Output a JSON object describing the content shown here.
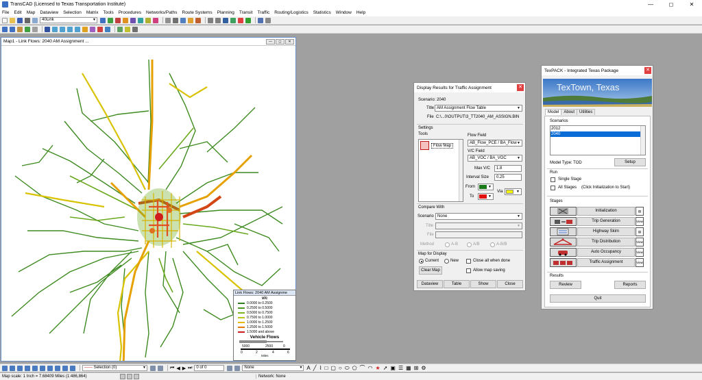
{
  "app": {
    "title": "TransCAD (Licensed to Texas Transportation Institute)",
    "win_min": "—",
    "win_max": "◻",
    "win_close": "✕"
  },
  "menu": [
    "File",
    "Edit",
    "Map",
    "Dataview",
    "Selection",
    "Matrix",
    "Tools",
    "Procedures",
    "Networks/Paths",
    "Route Systems",
    "Planning",
    "Transit",
    "Traffic",
    "Routing/Logistics",
    "Statistics",
    "Window",
    "Help"
  ],
  "toolbar": {
    "layer_combo": "40Link"
  },
  "map_window": {
    "title": "Map1 - Link Flows: 2040 AM Assignment ...",
    "legend": {
      "header": "Link Flows: 2040 AM Assignme",
      "vc_title": "v/c",
      "rows": [
        {
          "label": "0.0000 to 0.2500",
          "color": "#2e7d1e"
        },
        {
          "label": "0.2500 to 0.5000",
          "color": "#4e9a1e"
        },
        {
          "label": "0.5000 to 0.7500",
          "color": "#7db21a"
        },
        {
          "label": "0.7500 to 1.0000",
          "color": "#b8c415"
        },
        {
          "label": "1.0000 to 1.2500",
          "color": "#e6b800"
        },
        {
          "label": "1.2500 to 1.5000",
          "color": "#e67a00"
        },
        {
          "label": "1.5000 and above",
          "color": "#d01c1c"
        }
      ],
      "flows_title": "Vehicle Flows",
      "flow_5000": "5000",
      "flow_2500": "2500",
      "flow_0": "0",
      "miles_ticks": [
        "0",
        "2",
        "4",
        "6"
      ],
      "miles_label": "Miles"
    }
  },
  "display_dialog": {
    "title": "Display Results for Traffic Assignment",
    "scenario_text": "Scenario: 2040",
    "title_label": "Title",
    "title_value": "AM Assignment Flow Table",
    "file_label": "File",
    "file_value": "C:\\...0\\OUTPUT\\3_TT2040_AM_ASSIGN.BIN",
    "settings_label": "Settings",
    "tools_label": "Tools",
    "tool_item": "Flow Map",
    "flow_field_label": "Flow Field",
    "flow_field_value": "AB_Flow_PCE / BA_Flow",
    "vc_field_label": "V/C Field",
    "vc_field_value": "AB_VOC / BA_VOC",
    "max_vc_label": "Max V/C",
    "max_vc_value": "1.8",
    "interval_label": "Interval Size",
    "interval_value": "0.25",
    "from_label": "From",
    "to_label": "To",
    "via_label": "Via",
    "from_color": "#1a7a1a",
    "to_color": "#e01010",
    "via_color": "#f0f000",
    "compare_label": "Compare With",
    "scenario_label": "Scenario",
    "scenario_value": "None",
    "ctitle_label": "Title",
    "cfile_label": "File",
    "method_label": "Method",
    "method_opts": [
      "A-B",
      "A/B",
      "A-B/B"
    ],
    "map_display_label": "Map for Display",
    "current_label": "Current",
    "new_label": "New",
    "close_all_label": "Close all when done",
    "allow_saving_label": "Allow map saving",
    "clear_map": "Clear Map",
    "buttons": [
      "Dataview",
      "Table",
      "Show",
      "Close"
    ]
  },
  "texpack": {
    "title": "TexPACK - Integrated Texas Package",
    "banner_text": "TexTown, Texas",
    "tabs": [
      "Model",
      "About",
      "Utilities"
    ],
    "scenarios_label": "Scenarios",
    "scenarios": [
      "2012",
      "2040"
    ],
    "selected_scenario": "2040",
    "model_type": "Model Type: TOD",
    "setup": "Setup",
    "run_label": "Run",
    "single_stage": "Single Stage",
    "all_stages": "All Stages",
    "all_stages_note": "(Click Initialization to Start)",
    "stages_label": "Stages",
    "stages": [
      "Initialization",
      "Trip Generation",
      "Highway Skim",
      "Trip Distribution",
      "Auto Occupancy",
      "Traffic Assignment"
    ],
    "view_label": "View",
    "results_label": "Results",
    "review": "Review",
    "reports": "Reports",
    "quit": "Quit"
  },
  "bottom": {
    "selection_combo": "Selection (0)",
    "page_of": "0 of 0",
    "none_combo": "None"
  },
  "status": {
    "scale": "Map scale: 1 Inch = 7.68409 Miles (1:486,864)",
    "network": "Network: None"
  }
}
